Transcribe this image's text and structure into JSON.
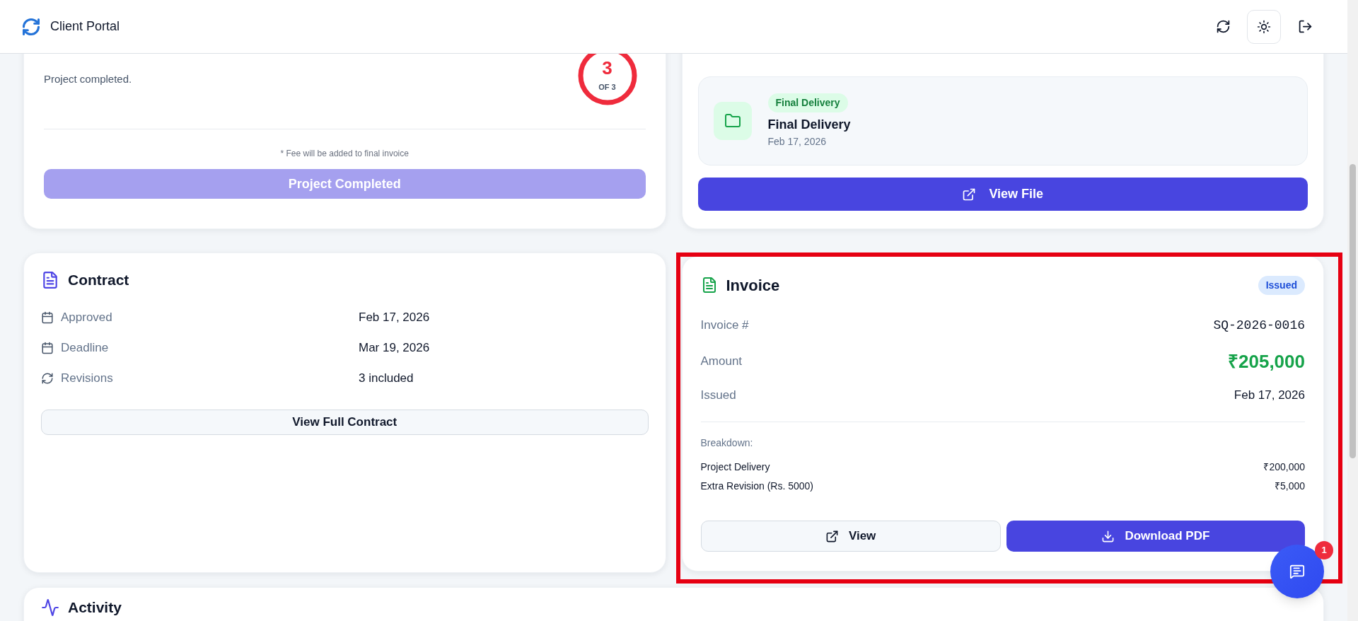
{
  "header": {
    "title": "Client Portal"
  },
  "revisions_card": {
    "status": "Project completed.",
    "count": "3",
    "count_of": "OF 3",
    "level": 1,
    "note": "* Fee will be added to final invoice",
    "button": {
      "label": "Project Completed",
      "disabled": true
    }
  },
  "delivery_card": {
    "badge": "Final Delivery",
    "title": "Final Delivery",
    "date": "Feb 17, 2026",
    "button": "View File"
  },
  "contract": {
    "title": "Contract",
    "rows": [
      {
        "kind": "calendar",
        "label": "Approved",
        "value": "Feb 17, 2026"
      },
      {
        "kind": "calendar",
        "label": "Deadline",
        "value": "Mar 19, 2026"
      },
      {
        "kind": "revisions",
        "label": "Revisions",
        "value": "3 included"
      }
    ],
    "button": "View Full Contract"
  },
  "invoice": {
    "title": "Invoice",
    "status": "Issued",
    "number_label": "Invoice #",
    "number": "SQ-2026-0016",
    "amount_label": "Amount",
    "amount": "₹205,000",
    "issued_label": "Issued",
    "issued": "Feb 17, 2026",
    "breakdown_label": "Breakdown:",
    "breakdown": [
      {
        "item": "Project Delivery",
        "amount": "₹200,000"
      },
      {
        "item": "Extra Revision (Rs. 5000)",
        "amount": "₹5,000"
      }
    ],
    "view_button": "View",
    "download_button": "Download PDF",
    "highlighted": true
  },
  "activity": {
    "title": "Activity"
  },
  "chat": {
    "unread": "1"
  }
}
